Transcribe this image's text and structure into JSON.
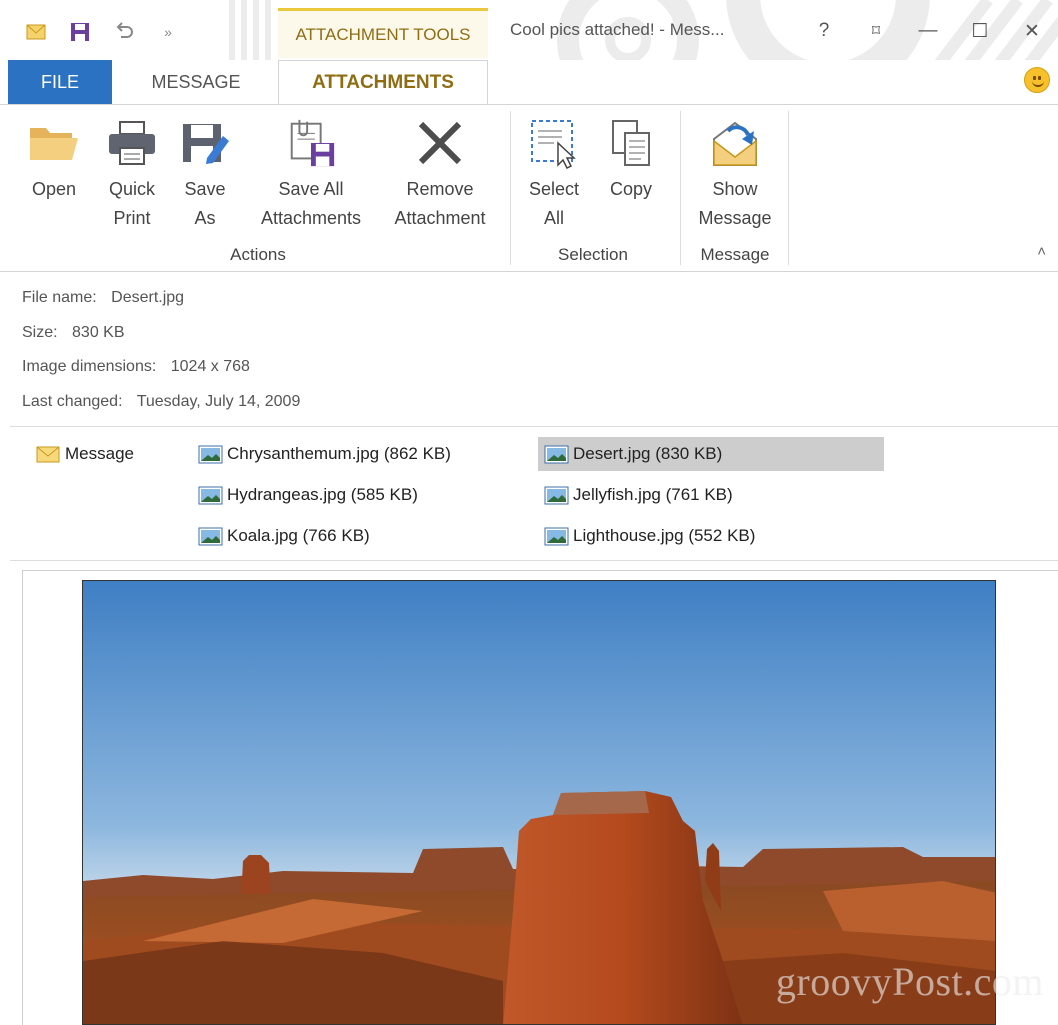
{
  "quick_access": {
    "icons": [
      "envelope-icon",
      "save-icon",
      "undo-icon",
      "more-icon"
    ],
    "more_glyph": "»"
  },
  "title_bar": {
    "context_tab": "ATTACHMENT TOOLS",
    "window_title": "Cool pics attached! - Mess...",
    "help": "?",
    "restore_ribbon": "⌑",
    "minimize": "—",
    "maximize": "☐",
    "close": "✕"
  },
  "tabs": {
    "file": "FILE",
    "message": "MESSAGE",
    "attachments": "ATTACHMENTS"
  },
  "ribbon": {
    "open": "Open",
    "quick_print": "Quick\nPrint",
    "save_as": "Save\nAs",
    "save_all": "Save All\nAttachments",
    "remove": "Remove\nAttachment",
    "select_all": "Select\nAll",
    "copy": "Copy",
    "show_message": "Show\nMessage",
    "groups": {
      "actions": "Actions",
      "selection": "Selection",
      "message": "Message"
    },
    "collapse": "˄"
  },
  "info": {
    "file_name_label": "File name:",
    "file_name": "Desert.jpg",
    "size_label": "Size:",
    "size": "830 KB",
    "dimensions_label": "Image dimensions:",
    "dimensions": "1024 x 768",
    "changed_label": "Last changed:",
    "changed": "Tuesday, July 14, 2009"
  },
  "attachments": {
    "message": "Message",
    "files": [
      "Chrysanthemum.jpg (862 KB)",
      "Desert.jpg (830 KB)",
      "Hydrangeas.jpg (585 KB)",
      "Jellyfish.jpg (761 KB)",
      "Koala.jpg (766 KB)",
      "Lighthouse.jpg (552 KB)"
    ],
    "selected": "Desert.jpg (830 KB)"
  },
  "preview": {
    "watermark": "groovyPost.com"
  },
  "colors": {
    "file_tab": "#2b73c2",
    "context_accent": "#e9c93b",
    "context_text": "#8f6d13",
    "selection": "#cdcdcd"
  }
}
